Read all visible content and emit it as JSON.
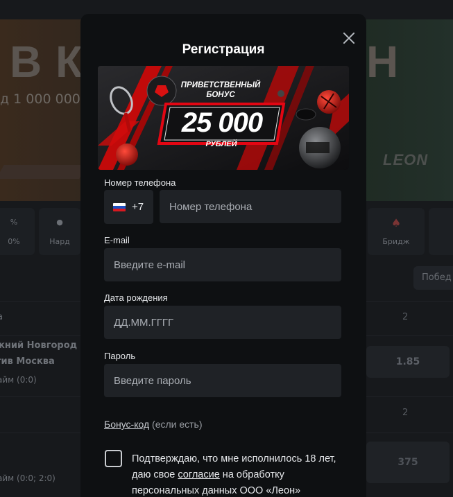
{
  "background": {
    "hero_title_left": "В КА",
    "hero_title_right": "Н",
    "hero_subtitle": "д 1 000 000",
    "hero_logo": "LEON",
    "categories": [
      {
        "label": "%",
        "sub": "0%"
      },
      {
        "label": "Нард",
        "sub": ""
      },
      {
        "label": "Бридж",
        "sub": ""
      }
    ],
    "filter_pill": "Побед",
    "rows": [
      {
        "text": "а",
        "value": "2"
      },
      {
        "text": "жний Новгород",
        "text2": "тив Москва",
        "text3": "айм (0:0)",
        "value": "1.85"
      },
      {
        "text": "",
        "value": "2"
      },
      {
        "text": "айм (0:0; 2:0)",
        "value": "375"
      }
    ]
  },
  "modal": {
    "title": "Регистрация",
    "banner": {
      "top_text_line1": "ПРИВЕТСТВЕННЫЙ",
      "top_text_line2": "БОНУС",
      "amount": "25 000",
      "currency": "РУБЛЕЙ"
    },
    "phone": {
      "label": "Номер телефона",
      "country_code": "+7",
      "placeholder": "Номер телефона"
    },
    "email": {
      "label": "E-mail",
      "placeholder": "Введите e-mail"
    },
    "birthdate": {
      "label": "Дата рождения",
      "placeholder": "ДД.ММ.ГГГГ"
    },
    "password": {
      "label": "Пароль",
      "placeholder": "Введите пароль"
    },
    "bonus_code": {
      "link": "Бонус-код",
      "hint": "(если есть)"
    },
    "consent": {
      "text_before": "Подтверждаю, что мне исполнилось 18 лет, даю свое ",
      "link": "согласие",
      "text_after": " на обработку персональных данных ООО «Леон»"
    }
  },
  "colors": {
    "modal_bg": "#0e1012",
    "field_bg": "#1f2226",
    "accent_red": "#e30613"
  }
}
